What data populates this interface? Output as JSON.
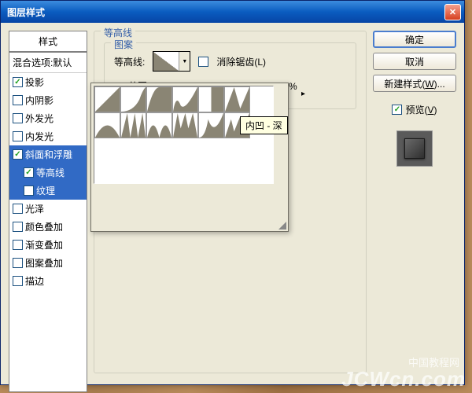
{
  "title": "图层样式",
  "left": {
    "header": "样式",
    "default": "混合选项:默认",
    "items": [
      {
        "label": "投影",
        "checked": true
      },
      {
        "label": "内阴影",
        "checked": false
      },
      {
        "label": "外发光",
        "checked": false
      },
      {
        "label": "内发光",
        "checked": false
      },
      {
        "label": "斜面和浮雕",
        "checked": true,
        "selected": true
      },
      {
        "label": "等高线",
        "checked": true,
        "sub": true,
        "selected": true
      },
      {
        "label": "纹理",
        "checked": false,
        "sub": true,
        "selected": true
      },
      {
        "label": "光泽",
        "checked": false
      },
      {
        "label": "颜色叠加",
        "checked": false
      },
      {
        "label": "渐变叠加",
        "checked": false
      },
      {
        "label": "图案叠加",
        "checked": false
      },
      {
        "label": "描边",
        "checked": false
      }
    ]
  },
  "mid": {
    "fieldset_title": "等高线",
    "inner_title": "图案",
    "contour_label": "等高线:",
    "anti_alias": "消除锯齿(L)",
    "range_label": "范围",
    "range_value": "%"
  },
  "right": {
    "ok": "确定",
    "cancel": "取消",
    "new_style": "新建样式(W)...",
    "preview_label": "预览(V)"
  },
  "tooltip": "内凹 - 深",
  "watermark": "JCWcn.com",
  "watermark_cn": "中国教程网",
  "popup_expand": "▸"
}
